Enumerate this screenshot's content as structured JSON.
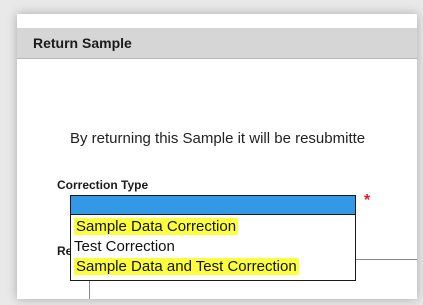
{
  "dialog": {
    "title": "Return Sample",
    "message": "By returning this Sample it will be resubmitte",
    "correction_type_label": "Correction Type",
    "required_marker": "*",
    "reason_label_partial": "Re"
  },
  "dropdown": {
    "selected_value": "",
    "options": [
      {
        "label": "Sample Data Correction",
        "highlighted": true
      },
      {
        "label": "Test Correction",
        "highlighted": false
      },
      {
        "label": "Sample Data and Test Correction",
        "highlighted": true
      }
    ]
  },
  "colors": {
    "selection_blue": "#3399e6",
    "highlight_yellow": "#fdff3c",
    "required_red": "#e02020",
    "titlebar_gray": "#d6d6d6"
  }
}
